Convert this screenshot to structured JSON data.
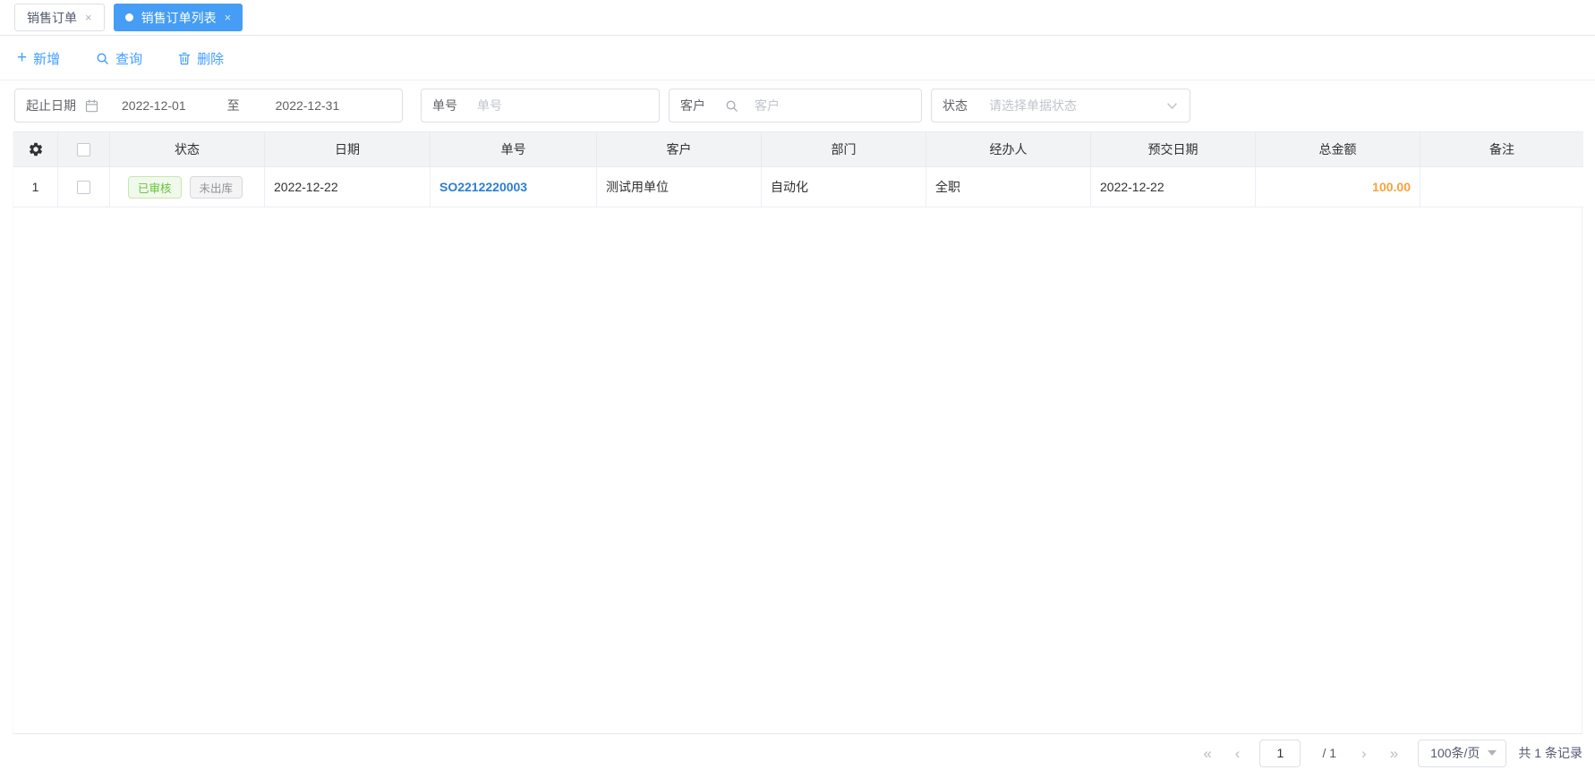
{
  "tabs": [
    {
      "label": "销售订单",
      "active": false
    },
    {
      "label": "销售订单列表",
      "active": true
    }
  ],
  "toolbar": {
    "add_label": "新增",
    "query_label": "查询",
    "delete_label": "删除"
  },
  "filters": {
    "date_range": {
      "label": "起止日期",
      "start": "2022-12-01",
      "separator": "至",
      "end": "2022-12-31"
    },
    "order_no": {
      "label": "单号",
      "placeholder": "单号",
      "value": ""
    },
    "customer": {
      "label": "客户",
      "placeholder": "客户",
      "value": ""
    },
    "status": {
      "label": "状态",
      "placeholder": "请选择单据状态"
    }
  },
  "table": {
    "columns": [
      "状态",
      "日期",
      "单号",
      "客户",
      "部门",
      "经办人",
      "预交日期",
      "总金额",
      "备注"
    ],
    "rows": [
      {
        "index": "1",
        "status_tags": [
          {
            "text": "已审核",
            "type": "success"
          },
          {
            "text": "未出库",
            "type": "info"
          }
        ],
        "date": "2022-12-22",
        "order_no": "SO2212220003",
        "customer": "测试用单位",
        "department": "自动化",
        "operator": "全职",
        "delivery_date": "2022-12-22",
        "total_amount": "100.00",
        "remark": ""
      }
    ]
  },
  "pagination": {
    "page": "1",
    "total_pages": "/ 1",
    "page_size": "100条/页",
    "total_records": "共 1 条记录"
  },
  "icons": {
    "close": "×",
    "add": "+",
    "first_page": "«",
    "prev_page": "‹",
    "next_page": "›",
    "last_page": "»"
  },
  "colors": {
    "active_tab_blue": "#459df5",
    "toolbar_blue": "#409eff",
    "link_blue": "#2d7dd2",
    "amount_orange": "#f9a13c",
    "tag_success_text": "#67c23a",
    "tag_success_bg": "#f0f9eb",
    "tag_info_text": "#909399",
    "tag_info_bg": "#f4f4f5",
    "header_bg": "#f2f3f5"
  }
}
